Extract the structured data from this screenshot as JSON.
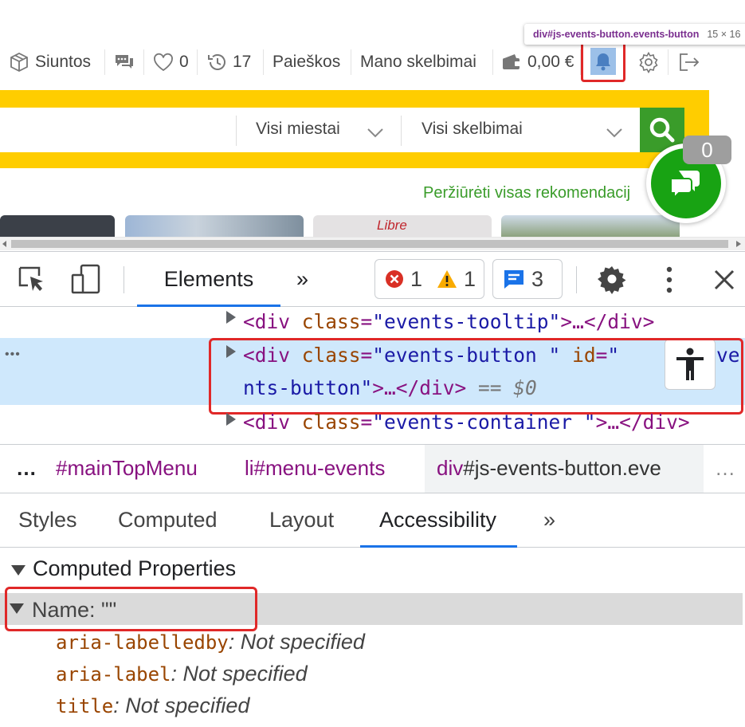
{
  "colors": {
    "accent_yellow": "#ffcd00",
    "accent_green": "#3a9c2a",
    "highlight_red": "#e02828",
    "devtools_blue": "#1a73e8",
    "selected_row": "#cfe8fc"
  },
  "site": {
    "nav": {
      "parcels": "Siuntos",
      "favorites_count": "0",
      "history_count": "17",
      "searches": "Paieškos",
      "my_ads": "Mano skelbimai",
      "wallet": "0,00 €"
    },
    "inspect_tooltip": {
      "selector": "div#js-events-button.events-button",
      "size": "15 × 16"
    },
    "search": {
      "city_select": "Visi miestai",
      "category_select": "Visi skelbimai"
    },
    "recommendations_link": "Peržiūrėti visas rekomendacij",
    "thumb_text": "Libre",
    "chat_badge": "0"
  },
  "devtools": {
    "tabs": {
      "elements": "Elements",
      "more": "»"
    },
    "counters": {
      "errors": "1",
      "warnings": "1",
      "messages": "3"
    },
    "dom": {
      "line1": {
        "open": "<div ",
        "attr": "class",
        "eq": "=",
        "val": "\"events-tooltip\"",
        "rest": ">…</div>"
      },
      "line2a": {
        "open": "<div ",
        "attr1": "class",
        "eq1": "=",
        "val1": "\"events-button \"",
        "sp": " ",
        "attr2": "id",
        "eq2": "=",
        "val2a": "\"",
        "val2b": "ve"
      },
      "line2b": {
        "val": "nts-button\"",
        "rest": ">…</div>",
        "eq": " == ",
        "ref": "$0"
      },
      "line3": {
        "open": "<div ",
        "attr": "class",
        "eq": "=",
        "val": "\"events-container \"",
        "rest": ">…</div>"
      },
      "ellipsis": "•••"
    },
    "breadcrumbs": {
      "ellipsis_left": "…",
      "c1": "#mainTopMenu",
      "c2": "li#menu-events",
      "c3_tag": "div",
      "c3_rest": "#js-events-button.eve",
      "ellipsis_right": "…"
    },
    "subtabs": {
      "styles": "Styles",
      "computed": "Computed",
      "layout": "Layout",
      "accessibility": "Accessibility",
      "more": "»"
    },
    "accessibility": {
      "section": "Computed Properties",
      "name_label": "Name: \"\"",
      "props": [
        {
          "key": "aria-labelledby",
          "value": "Not specified"
        },
        {
          "key": "aria-label",
          "value": "Not specified"
        },
        {
          "key": "title",
          "value": "Not specified"
        }
      ]
    }
  }
}
